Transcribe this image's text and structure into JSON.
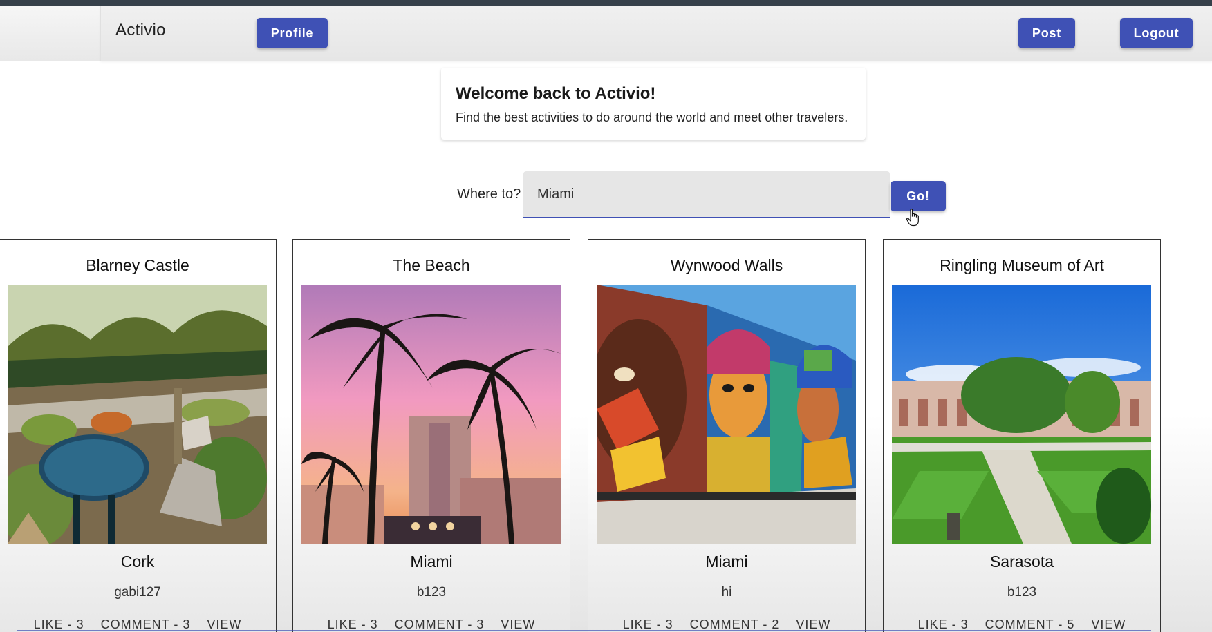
{
  "app": {
    "brand": "Activio"
  },
  "nav": {
    "profile_label": "Profile",
    "post_label": "Post",
    "logout_label": "Logout"
  },
  "welcome": {
    "title": "Welcome back to Activio!",
    "subtitle": "Find the best activities to do around the world and meet other travelers."
  },
  "search": {
    "label": "Where to?",
    "value": "Miami",
    "go_label": "Go!"
  },
  "colors": {
    "accent": "#3f51b5",
    "topbar": "#36404a"
  },
  "cards": [
    {
      "title": "Blarney Castle",
      "city": "Cork",
      "user": "gabi127",
      "like": "LIKE - 3",
      "comment": "COMMENT - 3",
      "view": "VIEW",
      "image": "garden-photo"
    },
    {
      "title": "The Beach",
      "city": "Miami",
      "user": "b123",
      "like": "LIKE - 3",
      "comment": "COMMENT - 3",
      "view": "VIEW",
      "image": "palm-sunset-photo"
    },
    {
      "title": "Wynwood Walls",
      "city": "Miami",
      "user": "hi",
      "like": "LIKE - 3",
      "comment": "COMMENT - 2",
      "view": "VIEW",
      "image": "mural-photo"
    },
    {
      "title": "Ringling Museum of Art",
      "city": "Sarasota",
      "user": "b123",
      "like": "LIKE - 3",
      "comment": "COMMENT - 5",
      "view": "VIEW",
      "image": "courtyard-photo"
    }
  ]
}
